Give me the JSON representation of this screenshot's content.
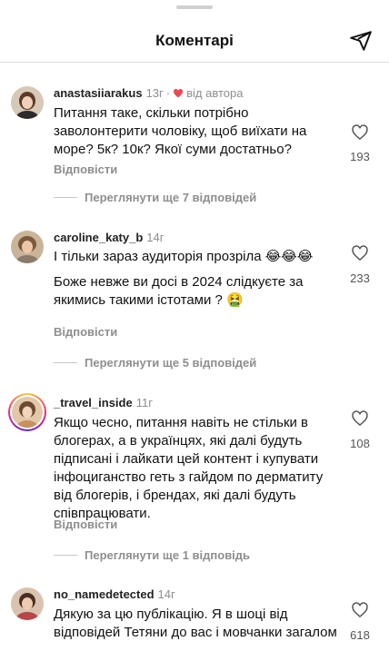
{
  "header": {
    "title": "Коментарі",
    "share_icon": "send-icon"
  },
  "comments": [
    {
      "username": "anastasiiarakus",
      "time": "13г",
      "author_liked": "від автора",
      "text": "Питання таке, скільки потрібно заволонтерити чоловіку, щоб виїхати на море?  5к? 10к? Якої суми достатньо?",
      "likes": "193",
      "reply_label": "Відповісти",
      "view_replies": "Переглянути ще 7 відповідей"
    },
    {
      "username": "caroline_katy_b",
      "time": "14г",
      "text_line1": "І тільки зараз аудиторія прозріла 😂😂😂",
      "text_line2": "Боже невже ви досі в 2024 слідкуєте за якимись такими істотами ? 🤮",
      "likes": "233",
      "reply_label": "Відповісти",
      "view_replies": "Переглянути ще 5 відповідей"
    },
    {
      "username": "_travel_inside",
      "time": "11г",
      "text": "Якщо чесно, питання навіть не стільки в блогерах, а в українцях, які далі будуть підписані і лайкати цей контент і купувати інфоциганство геть з гайдом по дерматиту від блогерів, і брендах, які далі будуть співпрацювати.",
      "likes": "108",
      "reply_label": "Відповісти",
      "view_replies": "Переглянути ще 1 відповідь"
    },
    {
      "username": "no_namedetected",
      "time": "14г",
      "text": "Дякую за цю публікацію. Я в шоці від відповідей Тетяни до вас і мовчанки загалом",
      "likes": "618"
    }
  ],
  "colors": {
    "heart_red": "#ed4956",
    "muted": "#8e8e8e"
  }
}
